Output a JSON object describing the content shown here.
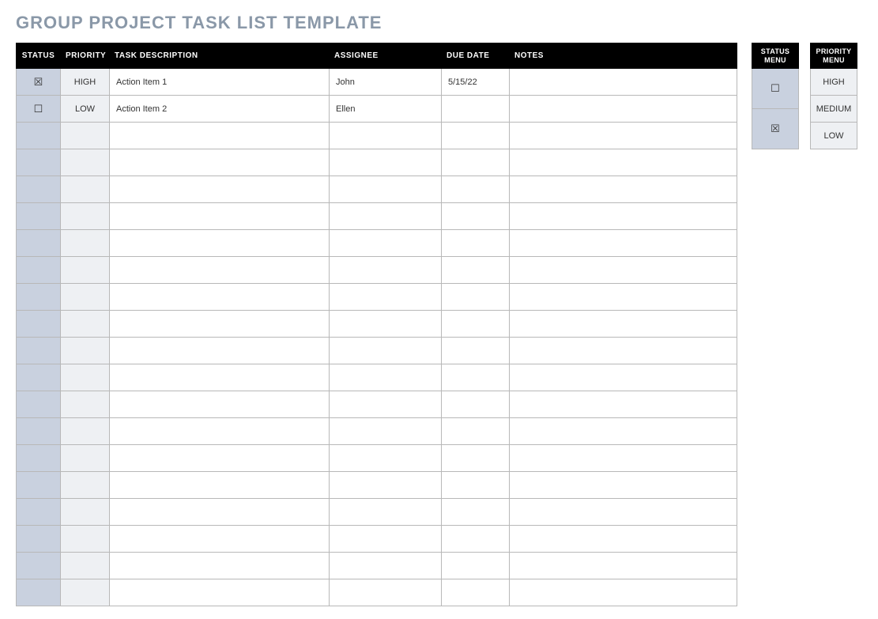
{
  "title": "GROUP PROJECT TASK LIST TEMPLATE",
  "headers": {
    "status": "STATUS",
    "priority": "PRIORITY",
    "task": "TASK DESCRIPTION",
    "assignee": "ASSIGNEE",
    "due": "DUE DATE",
    "notes": "NOTES"
  },
  "rows": [
    {
      "status": "☒",
      "priority": "HIGH",
      "task": "Action Item 1",
      "assignee": "John",
      "due": "5/15/22",
      "notes": ""
    },
    {
      "status": "☐",
      "priority": "LOW",
      "task": "Action Item 2",
      "assignee": "Ellen",
      "due": "",
      "notes": ""
    },
    {
      "status": "",
      "priority": "",
      "task": "",
      "assignee": "",
      "due": "",
      "notes": ""
    },
    {
      "status": "",
      "priority": "",
      "task": "",
      "assignee": "",
      "due": "",
      "notes": ""
    },
    {
      "status": "",
      "priority": "",
      "task": "",
      "assignee": "",
      "due": "",
      "notes": ""
    },
    {
      "status": "",
      "priority": "",
      "task": "",
      "assignee": "",
      "due": "",
      "notes": ""
    },
    {
      "status": "",
      "priority": "",
      "task": "",
      "assignee": "",
      "due": "",
      "notes": ""
    },
    {
      "status": "",
      "priority": "",
      "task": "",
      "assignee": "",
      "due": "",
      "notes": ""
    },
    {
      "status": "",
      "priority": "",
      "task": "",
      "assignee": "",
      "due": "",
      "notes": ""
    },
    {
      "status": "",
      "priority": "",
      "task": "",
      "assignee": "",
      "due": "",
      "notes": ""
    },
    {
      "status": "",
      "priority": "",
      "task": "",
      "assignee": "",
      "due": "",
      "notes": ""
    },
    {
      "status": "",
      "priority": "",
      "task": "",
      "assignee": "",
      "due": "",
      "notes": ""
    },
    {
      "status": "",
      "priority": "",
      "task": "",
      "assignee": "",
      "due": "",
      "notes": ""
    },
    {
      "status": "",
      "priority": "",
      "task": "",
      "assignee": "",
      "due": "",
      "notes": ""
    },
    {
      "status": "",
      "priority": "",
      "task": "",
      "assignee": "",
      "due": "",
      "notes": ""
    },
    {
      "status": "",
      "priority": "",
      "task": "",
      "assignee": "",
      "due": "",
      "notes": ""
    },
    {
      "status": "",
      "priority": "",
      "task": "",
      "assignee": "",
      "due": "",
      "notes": ""
    },
    {
      "status": "",
      "priority": "",
      "task": "",
      "assignee": "",
      "due": "",
      "notes": ""
    },
    {
      "status": "",
      "priority": "",
      "task": "",
      "assignee": "",
      "due": "",
      "notes": ""
    },
    {
      "status": "",
      "priority": "",
      "task": "",
      "assignee": "",
      "due": "",
      "notes": ""
    }
  ],
  "status_menu": {
    "header": "STATUS MENU",
    "items": [
      "☐",
      "☒"
    ]
  },
  "priority_menu": {
    "header": "PRIORITY MENU",
    "items": [
      "HIGH",
      "MEDIUM",
      "LOW"
    ]
  }
}
